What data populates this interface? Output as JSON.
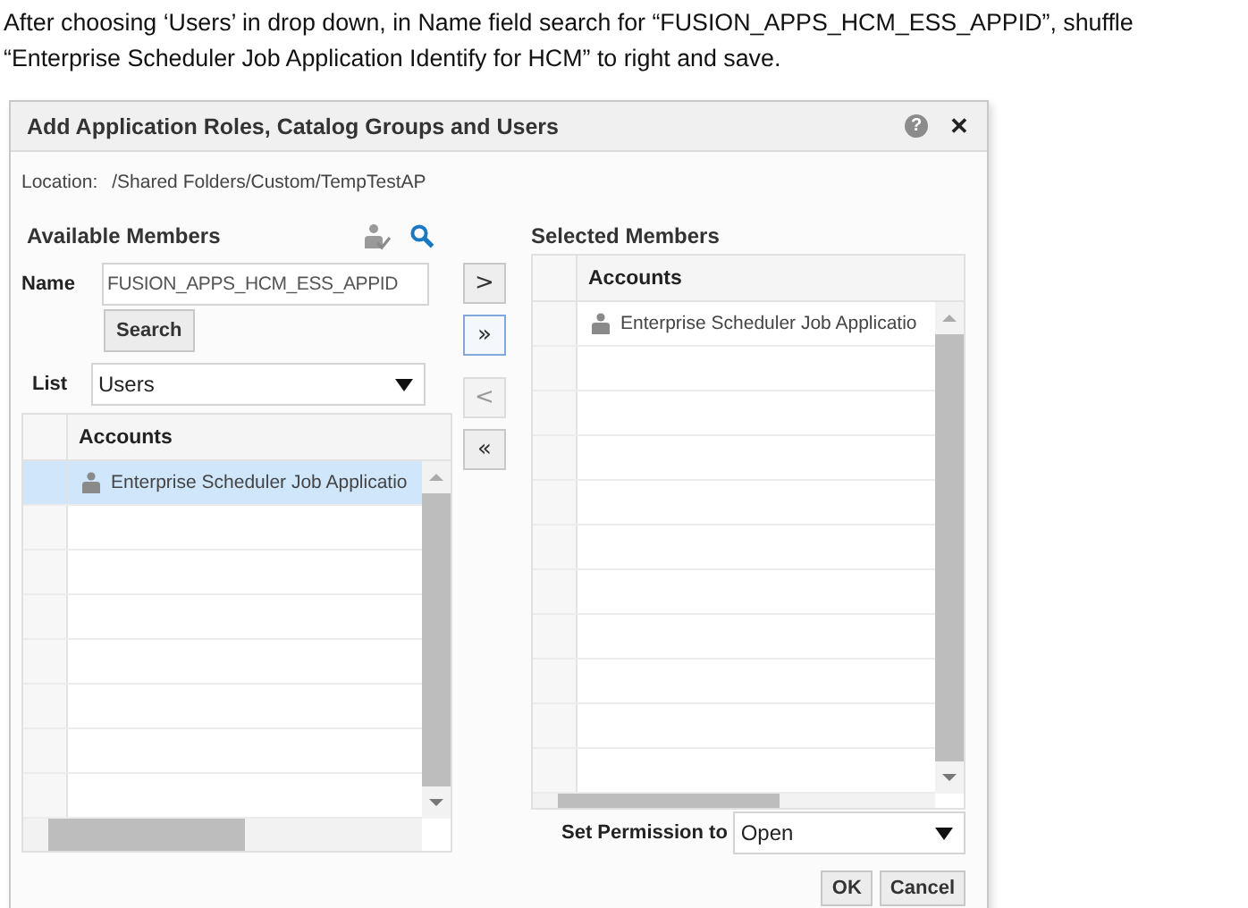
{
  "instruction": "After choosing ‘Users’ in drop down, in Name field search for “FUSION_APPS_HCM_ESS_APPID”, shuffle “Enterprise Scheduler Job Application Identify for HCM” to right and save.",
  "dialog": {
    "title": "Add Application Roles, Catalog Groups and Users",
    "help": "?",
    "close": "✕",
    "location_label": "Location:",
    "location": "/Shared Folders/Custom/TempTestAP",
    "available": {
      "title": "Available Members",
      "name_label": "Name",
      "name_value": "FUSION_APPS_HCM_ESS_APPID",
      "search_button": "Search",
      "list_label": "List",
      "list_value": "Users",
      "table": {
        "column": "Accounts",
        "rows": [
          {
            "account": "Enterprise Scheduler Job Applicatio",
            "selected": true
          }
        ]
      }
    },
    "transfer_buttons": [
      {
        "label": ">",
        "disabled": false,
        "focused": false
      },
      {
        "label": "»",
        "disabled": false,
        "focused": true
      },
      {
        "label": "<",
        "disabled": true,
        "focused": false
      },
      {
        "label": "«",
        "disabled": false,
        "focused": false
      }
    ],
    "selected": {
      "title": "Selected Members",
      "table": {
        "column": "Accounts",
        "rows": [
          {
            "account": "Enterprise Scheduler Job Applicatio",
            "selected": false
          }
        ]
      },
      "permission_label": "Set Permission to",
      "permission_value": "Open"
    },
    "buttons": [
      "OK",
      "Cancel"
    ]
  }
}
